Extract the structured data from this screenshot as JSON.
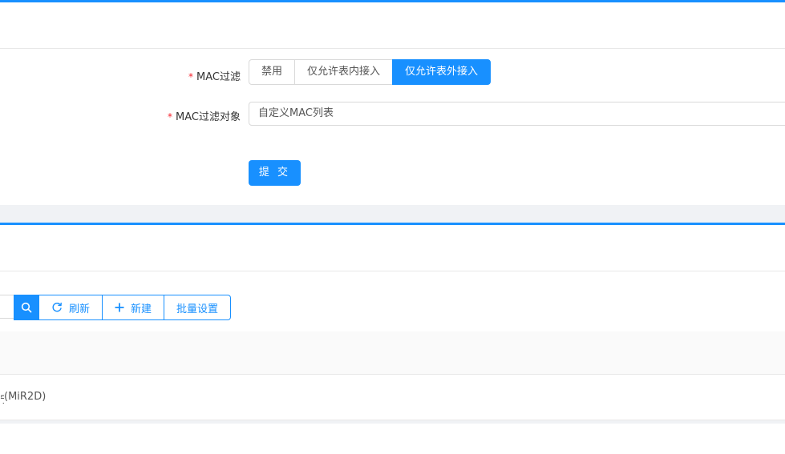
{
  "form": {
    "mac_filter": {
      "label": "MAC过滤",
      "required_mark": "*",
      "options": [
        "禁用",
        "仅允许表内接入",
        "仅允许表外接入"
      ],
      "selected": "仅允许表外接入"
    },
    "mac_filter_target": {
      "label": "MAC过滤对象",
      "required_mark": "*",
      "value": "自定义MAC列表"
    },
    "submit_label": "提 交"
  },
  "toolbar": {
    "search_icon": "search-icon",
    "refresh_label": "刷新",
    "add_label": "新建",
    "batch_label": "批量设置"
  },
  "table": {
    "rows": [
      {
        "name_partial": "(MiR2D)"
      }
    ]
  },
  "colors": {
    "primary": "#1890ff",
    "required": "#f5222d",
    "page_bg": "#f0f2f5"
  }
}
